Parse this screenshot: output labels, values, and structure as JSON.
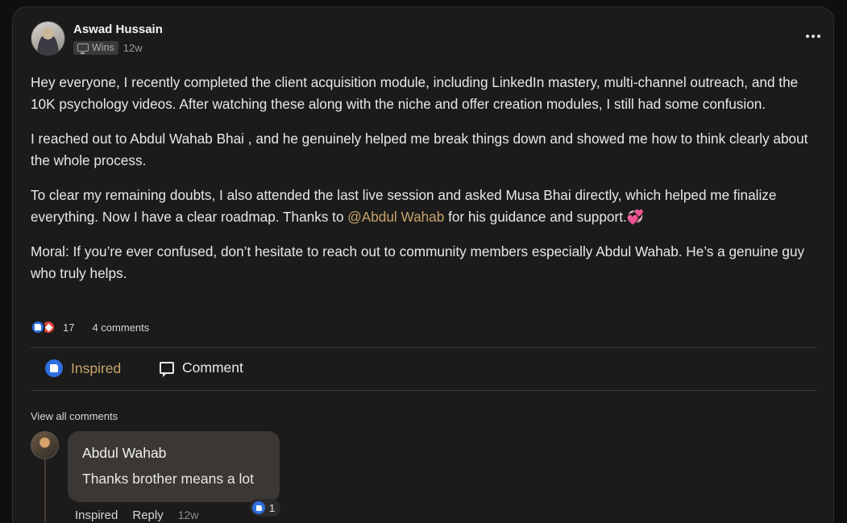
{
  "post": {
    "author_name": "Aswad Hussain",
    "category": "Wins",
    "category_icon": "monitor-icon",
    "time_ago": "12w",
    "paragraphs": {
      "p1": "Hey everyone, I recently completed the client acquisition module, including LinkedIn mastery, multi-channel outreach, and the 10K psychology videos. After watching these along with the niche and offer creation modules, I still had some confusion.",
      "p2": "I reached out to Abdul Wahab Bhai , and he genuinely helped me break things down and showed me how to think clearly about the whole process.",
      "p3_before": "To clear my remaining doubts, I also attended the last live session and asked Musa Bhai directly, which helped me finalize everything. Now I have a clear roadmap. Thanks to ",
      "p3_mention": "@Abdul Wahab",
      "p3_after": " for his guidance and support.",
      "p3_emoji": "💞",
      "p4": "Moral: If you’re ever confused, don’t hesitate to reach out to community members especially Abdul Wahab. He’s a genuine guy who truly helps."
    },
    "reaction_count": "17",
    "comment_count": "4 comments",
    "accent_color": "#c9a46a",
    "like_color": "#2e6fe0"
  },
  "actions": {
    "inspired_label": "Inspired",
    "comment_label": "Comment"
  },
  "comments": {
    "view_all_label": "View all comments",
    "items": [
      {
        "author": "Abdul Wahab",
        "text": "Thanks brother means a lot",
        "reaction_count": "1",
        "inspired_label": "Inspired",
        "reply_label": "Reply",
        "time_ago": "12w"
      }
    ]
  }
}
